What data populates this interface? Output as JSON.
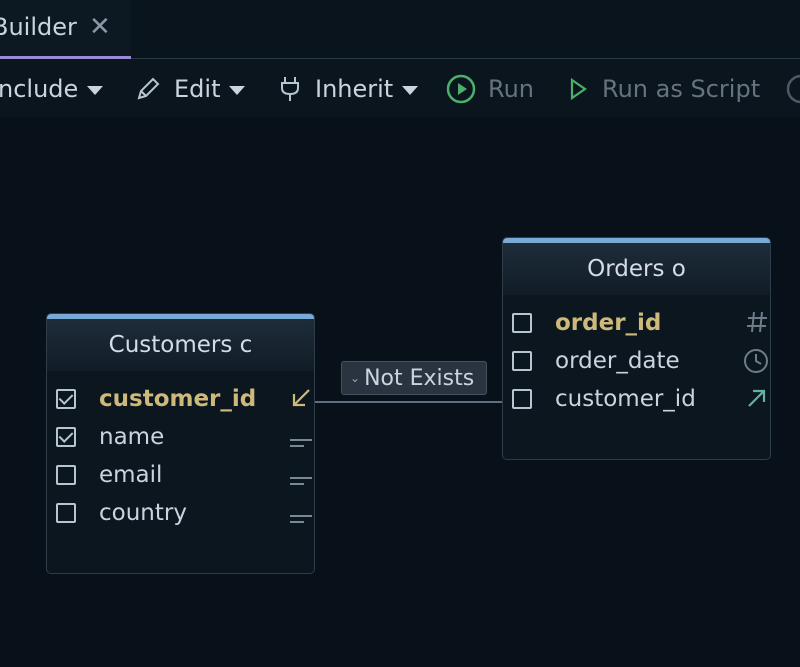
{
  "tab": {
    "title": "Builder",
    "close_glyph": "✕"
  },
  "toolbar": {
    "include_label": "nclude",
    "edit_label": "Edit",
    "inherit_label": "Inherit",
    "run_label": "Run",
    "run_script_label": "Run as Script"
  },
  "join": {
    "label": "Not Exists"
  },
  "tables": {
    "customers": {
      "title": "Customers c",
      "columns": [
        {
          "name": "customer_id",
          "checked": true,
          "key": true,
          "icon": "foreign-key-arrow-icon"
        },
        {
          "name": "name",
          "checked": true,
          "key": false,
          "icon": "text-type-icon"
        },
        {
          "name": "email",
          "checked": false,
          "key": false,
          "icon": "text-type-icon"
        },
        {
          "name": "country",
          "checked": false,
          "key": false,
          "icon": "text-type-icon"
        }
      ]
    },
    "orders": {
      "title": "Orders o",
      "columns": [
        {
          "name": "order_id",
          "checked": false,
          "key": true,
          "icon": "number-type-icon"
        },
        {
          "name": "order_date",
          "checked": false,
          "key": false,
          "icon": "clock-icon"
        },
        {
          "name": "customer_id",
          "checked": false,
          "key": false,
          "icon": "foreign-key-arrow-icon"
        }
      ]
    }
  },
  "colors": {
    "background": "#08111a",
    "key_column": "#cdb97a",
    "table_header_bar": "#79a9d6",
    "tab_active_underline": "#9a8ad8",
    "run_green": "#4caf6a"
  }
}
